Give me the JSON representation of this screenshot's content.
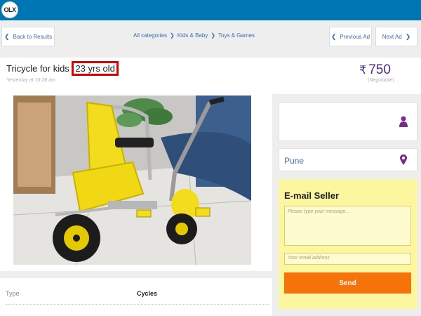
{
  "brand": {
    "logo_text": "OLX"
  },
  "nav": {
    "back_label": "Back to Results",
    "prev_label": "Previous Ad",
    "next_label": "Next Ad"
  },
  "breadcrumb": [
    "All categories",
    "Kids & Baby",
    "Toys & Games"
  ],
  "ad": {
    "title_main": "Tricycle for kids",
    "title_highlight": "23 yrs old",
    "posted": "Yesterday at 10:28 am",
    "currency": "₹",
    "price": "750",
    "negotiable": "(Negotiable)"
  },
  "photo": {
    "subject": "yellow children's tricycle"
  },
  "details": [
    {
      "label": "Type",
      "value": "Cycles"
    }
  ],
  "seller": {
    "location": "Pune"
  },
  "contact": {
    "title": "E-mail Seller",
    "message_placeholder": "Please type your message...",
    "email_placeholder": "Your email address",
    "send_label": "Send"
  },
  "colors": {
    "topbar": "#0075b3",
    "link": "#3a6fb0",
    "price": "#4b2b8c",
    "highlight_border": "#e00000",
    "contact_bg": "#fdf6a0",
    "send_button": "#f5730a"
  }
}
